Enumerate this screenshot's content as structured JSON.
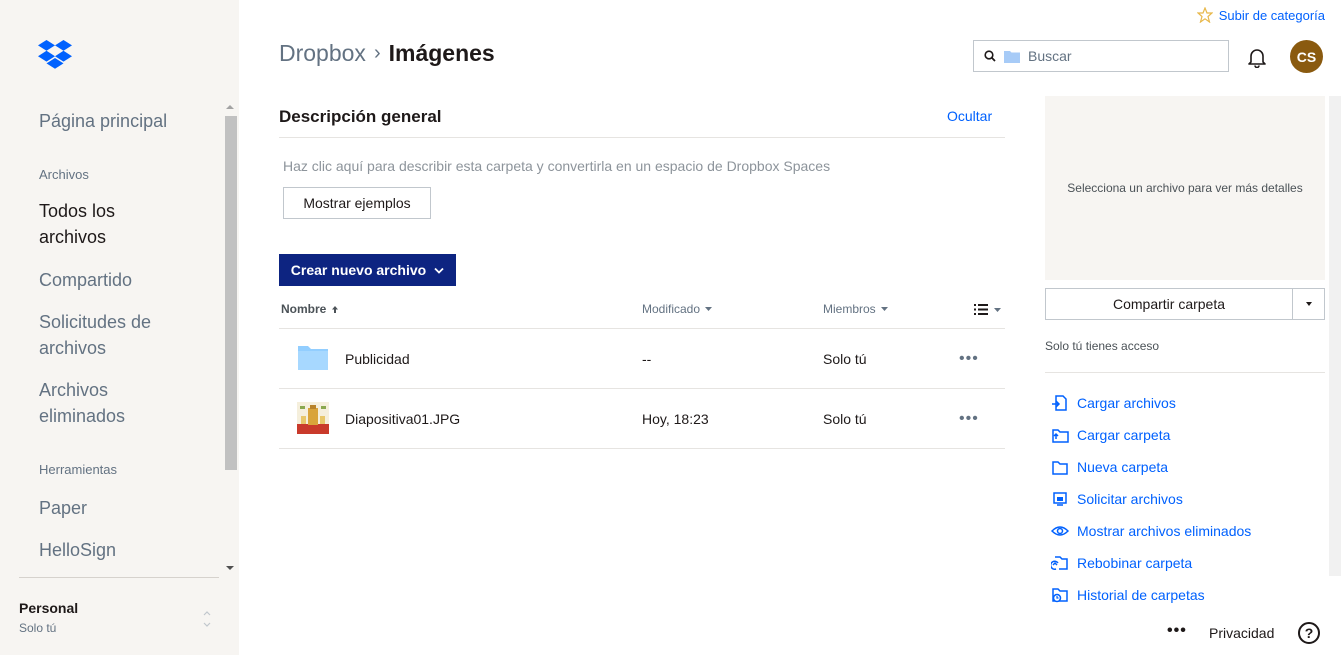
{
  "sidebar": {
    "home": "Página principal",
    "section_files": "Archivos",
    "items": [
      "Todos los archivos",
      "Compartido",
      "Solicitudes de archivos",
      "Archivos eliminados"
    ],
    "section_tools": "Herramientas",
    "tools": [
      "Paper",
      "HelloSign"
    ],
    "account_name": "Personal",
    "account_sub": "Solo tú"
  },
  "header": {
    "upgrade": "Subir de categoría",
    "breadcrumb_root": "Dropbox",
    "breadcrumb_separator": "›",
    "breadcrumb_current": "Imágenes",
    "search_placeholder": "Buscar",
    "avatar_initials": "CS"
  },
  "overview": {
    "title": "Descripción general",
    "hide": "Ocultar",
    "description": "Haz clic aquí para describir esta carpeta y convertirla en un espacio de Dropbox Spaces",
    "examples_button": "Mostrar ejemplos"
  },
  "create_button": "Crear nuevo archivo",
  "table": {
    "headers": {
      "name": "Nombre",
      "modified": "Modificado",
      "members": "Miembros"
    },
    "rows": [
      {
        "name": "Publicidad",
        "modified": "--",
        "members": "Solo tú",
        "icon": "folder-icon"
      },
      {
        "name": "Diapositiva01.JPG",
        "modified": "Hoy, 18:23",
        "members": "Solo tú",
        "icon": "image-thumbnail"
      }
    ],
    "more": "•••"
  },
  "panel": {
    "preview_text": "Selecciona un archivo para ver más detalles",
    "share_button": "Compartir carpeta",
    "access": "Solo tú tienes acceso",
    "actions": [
      "Cargar archivos",
      "Cargar carpeta",
      "Nueva carpeta",
      "Solicitar archivos",
      "Mostrar archivos eliminados",
      "Rebobinar carpeta",
      "Historial de carpetas"
    ]
  },
  "footer": {
    "more": "•••",
    "privacy": "Privacidad",
    "help": "?"
  },
  "colors": {
    "accent": "#0061fe",
    "create": "#0d2481",
    "avatar": "#8a5a0f"
  }
}
